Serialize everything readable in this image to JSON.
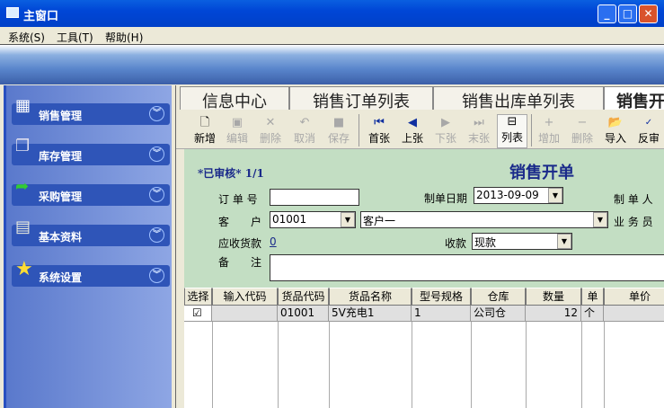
{
  "window": {
    "title": "主窗口"
  },
  "menu": [
    "系统(S)",
    "工具(T)",
    "帮助(H)"
  ],
  "sidebar": [
    {
      "label": "销售管理",
      "icon": "grid-icon"
    },
    {
      "label": "库存管理",
      "icon": "documents-icon"
    },
    {
      "label": "采购管理",
      "icon": "folder-arrow-icon"
    },
    {
      "label": "基本资料",
      "icon": "clipboard-icon"
    },
    {
      "label": "系统设置",
      "icon": "star-icon"
    }
  ],
  "tabs": [
    "信息中心",
    "销售订单列表",
    "销售出库单列表",
    "销售开单"
  ],
  "toolbar": [
    {
      "label": "新增",
      "icon": "new-doc-icon",
      "enabled": true
    },
    {
      "label": "编辑",
      "icon": "edit-icon",
      "enabled": false
    },
    {
      "label": "删除",
      "icon": "delete-icon",
      "enabled": false
    },
    {
      "label": "取消",
      "icon": "undo-icon",
      "enabled": false
    },
    {
      "label": "保存",
      "icon": "save-icon",
      "enabled": false
    },
    {
      "label": "首张",
      "icon": "first-icon",
      "enabled": true
    },
    {
      "label": "上张",
      "icon": "prev-icon",
      "enabled": true
    },
    {
      "label": "下张",
      "icon": "next-icon",
      "enabled": false
    },
    {
      "label": "末张",
      "icon": "last-icon",
      "enabled": false
    },
    {
      "label": "列表",
      "icon": "list-icon",
      "enabled": true
    },
    {
      "label": "增加",
      "icon": "plus-icon",
      "enabled": false
    },
    {
      "label": "删除",
      "icon": "minus-icon",
      "enabled": false
    },
    {
      "label": "导入",
      "icon": "import-icon",
      "enabled": true
    },
    {
      "label": "反审",
      "icon": "spellcheck-icon",
      "enabled": true
    }
  ],
  "form": {
    "status": "*已审核* 1/1",
    "title": "销售开单",
    "order_no_label": "订 单 号",
    "order_no": "",
    "date_label": "制单日期",
    "date": "2013-09-09",
    "maker_label": "制 单 人",
    "customer_label": "客　　户",
    "customer_code": "01001",
    "customer_name": "客户一",
    "salesman_label": "业 务 员",
    "receivable_label": "应收货款",
    "receivable": "0",
    "payment_label": "收款",
    "payment": "现款",
    "remark_label": "备　　注",
    "remark": ""
  },
  "grid": {
    "columns": [
      "选择",
      "输入代码",
      "货品代码",
      "货品名称",
      "型号规格",
      "仓库",
      "数量",
      "单位",
      "单价"
    ],
    "rows": [
      {
        "checked": true,
        "input_code": "",
        "code": "01001",
        "name": "5V充电1",
        "spec": "1",
        "warehouse": "公司仓",
        "qty": "12",
        "unit": "个",
        "price": ""
      }
    ]
  }
}
